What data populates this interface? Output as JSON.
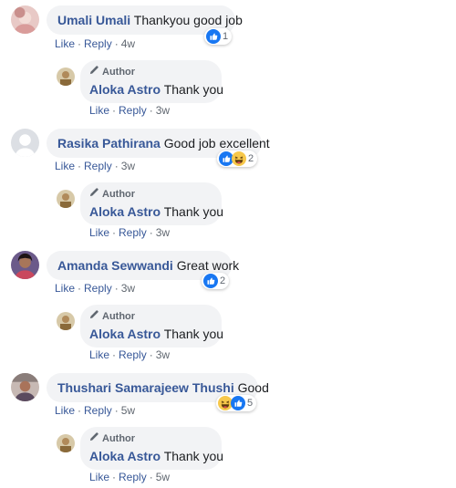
{
  "comments": [
    {
      "name": "Umali Umali",
      "text": "Thankyou good job",
      "like": "Like",
      "reply": "Reply",
      "time": "4w",
      "reaction_count": "1",
      "reactions": [
        "like-icon"
      ],
      "reply_item": {
        "badge": "Author",
        "name": "Aloka Astro",
        "text": "Thank you",
        "like": "Like",
        "reply": "Reply",
        "time": "3w"
      }
    },
    {
      "name": "Rasika Pathirana",
      "text": "Good job excellent",
      "like": "Like",
      "reply": "Reply",
      "time": "3w",
      "reaction_count": "2",
      "reactions": [
        "like-icon",
        "haha-icon"
      ],
      "reply_item": {
        "badge": "Author",
        "name": "Aloka Astro",
        "text": "Thank you",
        "like": "Like",
        "reply": "Reply",
        "time": "3w"
      }
    },
    {
      "name": "Amanda Sewwandi",
      "text": "Great work",
      "like": "Like",
      "reply": "Reply",
      "time": "3w",
      "reaction_count": "2",
      "reactions": [
        "like-icon"
      ],
      "reply_item": {
        "badge": "Author",
        "name": "Aloka Astro",
        "text": "Thank you",
        "like": "Like",
        "reply": "Reply",
        "time": "3w"
      }
    },
    {
      "name": "Thushari Samarajeew Thushi",
      "text": "Good",
      "like": "Like",
      "reply": "Reply",
      "time": "5w",
      "reaction_count": "5",
      "reactions": [
        "haha-icon",
        "like-icon"
      ],
      "reply_item": {
        "badge": "Author",
        "name": "Aloka Astro",
        "text": "Thank you",
        "like": "Like",
        "reply": "Reply",
        "time": "5w"
      }
    }
  ],
  "colors": {
    "link": "#385898",
    "bubble": "#f2f3f5",
    "meta": "#606770",
    "like_blue": "#1877f2",
    "haha_yellow": "#f7c84b"
  }
}
